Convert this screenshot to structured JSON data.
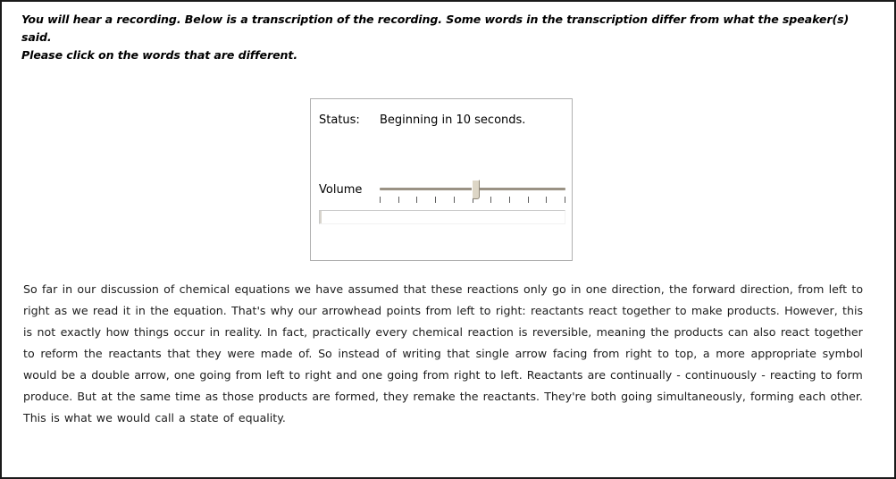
{
  "instructions": {
    "line1": "You will hear a recording. Below is a transcription of the recording. Some words in the transcription differ from what the speaker(s) said.",
    "line2": "Please click on the words that are different."
  },
  "player": {
    "status_label": "Status:",
    "status_value": "Beginning in 10 seconds.",
    "volume_label": "Volume",
    "volume_tick_count": 11,
    "volume_value_percent": 52,
    "progress_percent": 0,
    "colors": {
      "track": "#9a9284",
      "thumb": "#ddd6c6",
      "panel_border": "#b0b0b0"
    }
  },
  "transcript": {
    "text": "So far in our discussion of chemical equations we have assumed that these reactions only go in one direction, the forward direction, from left to right as we read it in the equation. That's why our arrowhead points from left to right: reactants react together to make products. However, this is not exactly how things occur in reality. In fact, practically every chemical reaction is reversible, meaning the products can also react together to reform the reactants that they were made of. So instead of writing that single arrow facing from right to top, a more appropriate symbol would be a double arrow, one going from left to right and one going from right to left. Reactants are continually - continuously - reacting to form produce. But at the same time as those products are formed, they remake the reactants. They're both going simultaneously, forming each other. This is what we would call a state of equality."
  }
}
